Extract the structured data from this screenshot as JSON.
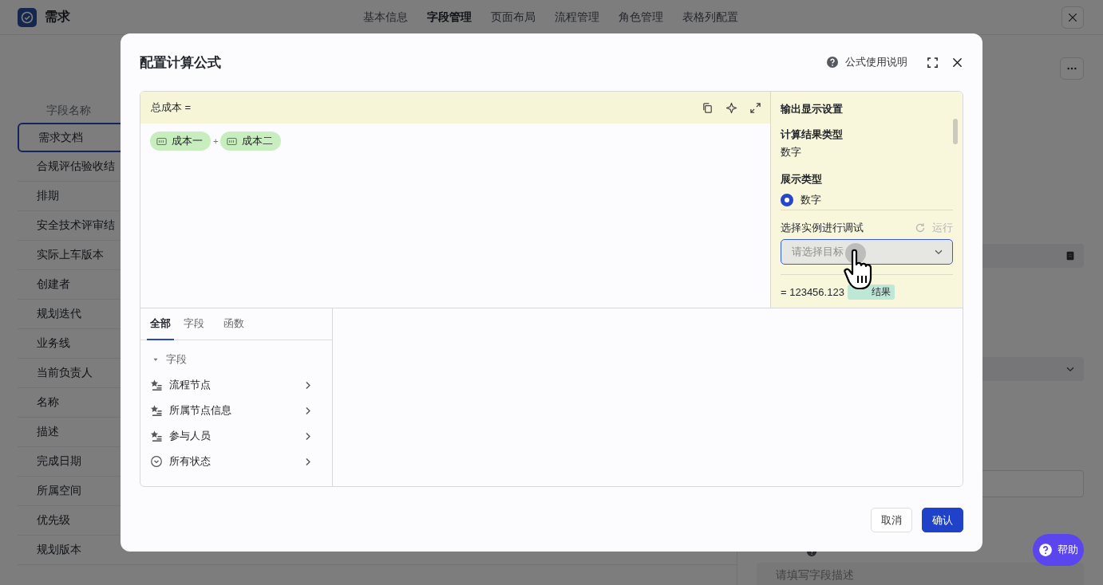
{
  "app": {
    "title": "需求",
    "tabs": [
      {
        "label": "基本信息",
        "selected": false
      },
      {
        "label": "字段管理",
        "selected": true
      },
      {
        "label": "页面布局",
        "selected": false
      },
      {
        "label": "流程管理",
        "selected": false
      },
      {
        "label": "角色管理",
        "selected": false
      },
      {
        "label": "表格列配置",
        "selected": false
      }
    ]
  },
  "field_table": {
    "header": "字段名称",
    "rows": [
      {
        "name": "需求文档",
        "selected": true
      },
      {
        "name": "合规评估验收结",
        "selected": false
      },
      {
        "name": "排期",
        "selected": false
      },
      {
        "name": "安全技术评审结",
        "selected": false
      },
      {
        "name": "实际上车版本",
        "selected": false
      },
      {
        "name": "创建者",
        "selected": false
      },
      {
        "name": "规划迭代",
        "selected": false
      },
      {
        "name": "业务线",
        "selected": false
      },
      {
        "name": "当前负责人",
        "selected": false
      },
      {
        "name": "名称",
        "selected": false
      },
      {
        "name": "描述",
        "selected": false
      },
      {
        "name": "完成日期",
        "selected": false
      },
      {
        "name": "所属空间",
        "selected": false
      },
      {
        "name": "优先级",
        "selected": false
      },
      {
        "name": "规划版本",
        "selected": false
      }
    ]
  },
  "side_panel": {
    "description_placeholder": "请填写字段描述"
  },
  "dialog": {
    "title": "配置计算公式",
    "help_link": "公式使用说明",
    "formula": {
      "target": "总成本 =",
      "tokens": [
        {
          "kind": "field",
          "label": "成本一"
        },
        {
          "kind": "operator",
          "label": "+"
        },
        {
          "kind": "field",
          "label": "成本二"
        }
      ]
    },
    "output": {
      "heading": "输出显示设置",
      "result_type_label": "计算结果类型",
      "result_type": "数字",
      "display_type_label": "展示类型",
      "display_options": [
        {
          "label": "数字",
          "selected": true
        }
      ],
      "debug_label": "选择实例进行调试",
      "run": {
        "label": "运行",
        "disabled": true
      },
      "target_select": {
        "placeholder": "请选择目标",
        "focused": true
      },
      "result": "= 123456.123",
      "result_badge": "结果"
    },
    "library": {
      "tabs": [
        {
          "label": "全部",
          "selected": true
        },
        {
          "label": "字段",
          "selected": false
        },
        {
          "label": "函数",
          "selected": false
        }
      ],
      "tree": [
        {
          "label": "字段",
          "expanded": true,
          "children": [
            {
              "label": "流程节点",
              "kind": "multi"
            },
            {
              "label": "所属节点信息",
              "kind": "multi"
            },
            {
              "label": "参与人员",
              "kind": "multi"
            },
            {
              "label": "所有状态",
              "kind": "status"
            }
          ]
        }
      ]
    },
    "buttons": [
      {
        "label": "取消",
        "kind": "secondary"
      },
      {
        "label": "确认",
        "kind": "primary"
      }
    ]
  },
  "help_button": "帮助"
}
